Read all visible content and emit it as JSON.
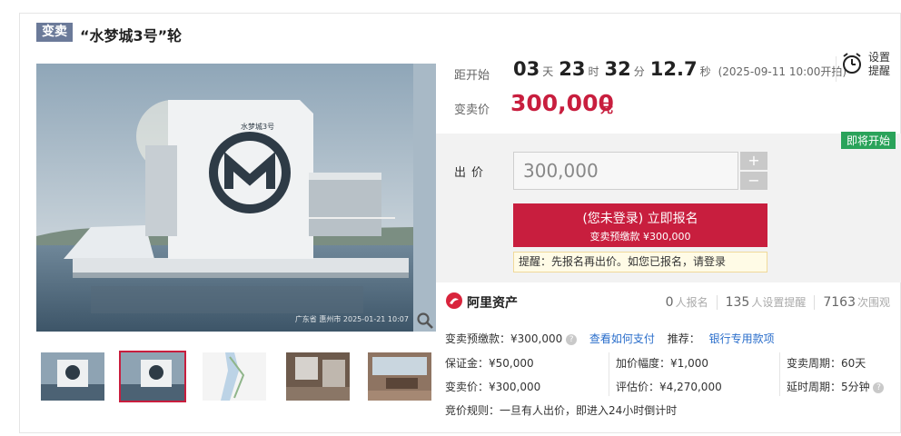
{
  "title": {
    "tag": "变卖",
    "text": "“水梦城3号”轮"
  },
  "gallery": {
    "watermark": "广东省 惠州市 2025-01-21 10:07",
    "thumbnails": [
      "thumb-1",
      "thumb-2",
      "thumb-3",
      "thumb-4",
      "thumb-5"
    ],
    "selected_index": 1
  },
  "countdown": {
    "label": "距开始",
    "days": "03",
    "days_unit": "天",
    "hours": "23",
    "hours_unit": "时",
    "minutes": "32",
    "minutes_unit": "分",
    "seconds": "12.7",
    "seconds_unit": "秒",
    "start_note": "(2025-09-11 10:00开拍)"
  },
  "remind": {
    "line1": "设置",
    "line2": "提醒"
  },
  "price": {
    "label": "变卖价",
    "value": "300,000",
    "unit": "元"
  },
  "bid": {
    "status": "即将开始",
    "label": "出价",
    "input_value": "300,000",
    "plus": "+",
    "minus": "−",
    "signup_main": "(您未登录) 立即报名",
    "signup_sub": "变卖预缴款 ¥300,000",
    "tip_text": "提醒：先报名再出价。如您已报名，请",
    "tip_link": "登录"
  },
  "platform": {
    "name": "阿里资产"
  },
  "stats": [
    {
      "num": "0",
      "label": "人报名"
    },
    {
      "num": "135",
      "label": "人设置提醒"
    },
    {
      "num": "7163",
      "label": "次围观"
    }
  ],
  "info": {
    "deposit_pre": "变卖预缴款：¥300,000",
    "how_to_pay": "查看如何支付",
    "recommend": "推荐：",
    "bank_link": "银行专用款项",
    "guarantee": "保证金：¥50,000",
    "increment": "加价幅度：¥1,000",
    "period": "变卖周期：60天",
    "sale_price": "变卖价：¥300,000",
    "appraisal": "评估价：¥4,270,000",
    "delay": "延时周期：5分钟",
    "rule": "竞价规则：一旦有人出价，即进入24小时倒计时"
  },
  "colors": {
    "accent": "#c81e3e",
    "tag_bg": "#6b7a99",
    "status_green": "#2aa35a",
    "link": "#2a6ecb"
  }
}
